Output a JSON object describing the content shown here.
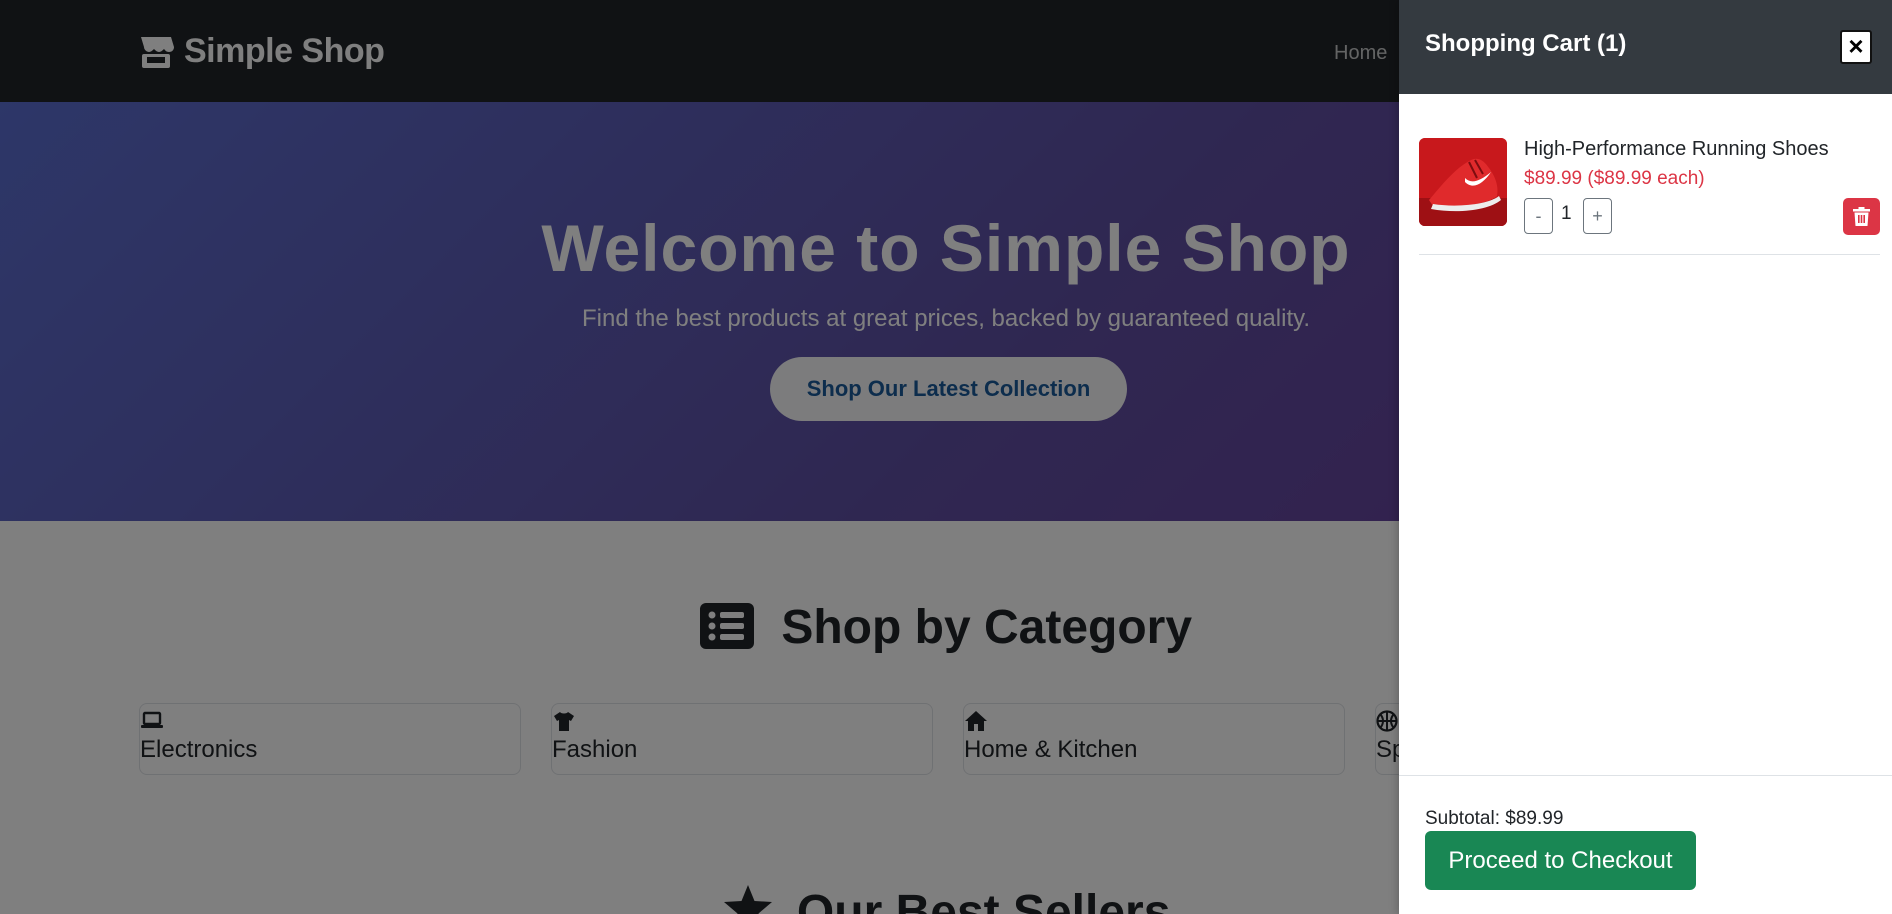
{
  "navbar": {
    "brand": "Simple Shop",
    "home_link": "Home"
  },
  "hero": {
    "title": "Welcome to Simple Shop",
    "subtitle": "Find the best products at great prices, backed by guaranteed quality.",
    "cta_label": "Shop Our Latest Collection"
  },
  "categories": {
    "title": "Shop by Category",
    "icon": "list-icon",
    "items": [
      {
        "label": "Electronics",
        "icon": "laptop-icon"
      },
      {
        "label": "Fashion",
        "icon": "shirt-icon"
      },
      {
        "label": "Home & Kitchen",
        "icon": "house-icon"
      },
      {
        "label": "Sp",
        "icon": "basketball-icon"
      }
    ]
  },
  "best_sellers": {
    "title": "Our Best Sellers",
    "icon": "star-icon"
  },
  "cart": {
    "title": "Shopping Cart (1)",
    "close_label": "×",
    "items": [
      {
        "name": "High-Performance Running Shoes",
        "price_line": "$89.99 ($89.99 each)",
        "quantity": "1",
        "decrement_label": "-",
        "increment_label": "+"
      }
    ],
    "subtotal": "Subtotal: $89.99",
    "checkout_label": "Proceed to Checkout"
  },
  "colors": {
    "navbar": "#212529",
    "cart_header": "#343a40",
    "price": "#dc3545",
    "checkout": "#198754",
    "hero_start": "#5b6ed1",
    "hero_end": "#6a3c9a"
  }
}
